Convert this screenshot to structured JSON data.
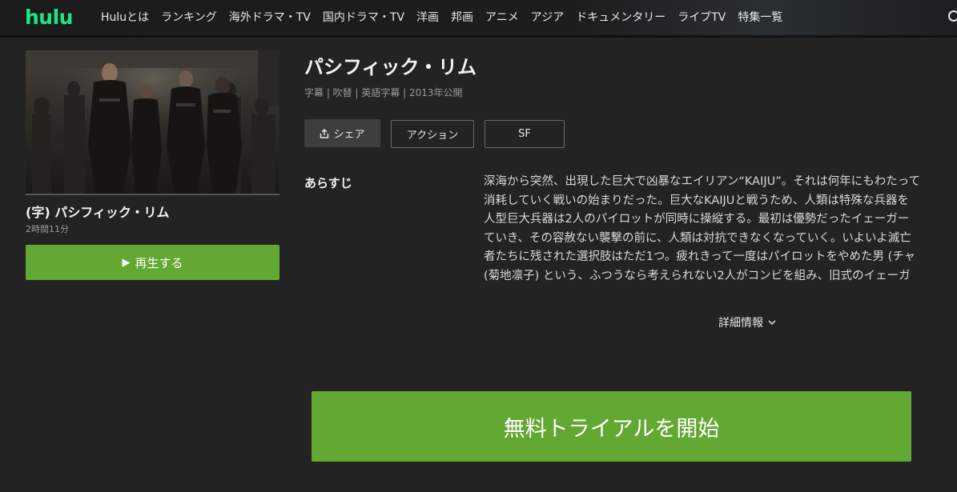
{
  "header": {
    "logo": "hulu",
    "nav": [
      "Huluとは",
      "ランキング",
      "海外ドラマ・TV",
      "国内ドラマ・TV",
      "洋画",
      "邦画",
      "アニメ",
      "アジア",
      "ドキュメンタリー",
      "ライブTV",
      "特集一覧"
    ]
  },
  "card": {
    "title": "(字) パシフィック・リム",
    "duration": "2時間11分",
    "play_label": "再生する"
  },
  "detail": {
    "title": "パシフィック・リム",
    "meta": "字幕 | 吹替 | 英語字幕 | 2013年公開",
    "share_label": "シェア",
    "tags": [
      "アクション",
      "SF"
    ],
    "synopsis_label": "あらすじ",
    "synopsis_lines": [
      "深海から突然、出現した巨大で凶暴なエイリアン“KAIJU”。それは何年にもわたって",
      "消耗していく戦いの始まりだった。巨大なKAIJUと戦うため、人類は特殊な兵器を",
      "人型巨大兵器は2人のパイロットが同時に操縦する。最初は優勢だったイェーガー",
      "ていき、その容赦ない襲撃の前に、人類は対抗できなくなっていく。いよいよ滅亡",
      "者たちに残された選択肢はただ1つ。疲れきって一度はパイロットをやめた男 (チャ",
      "(菊地凛子) という、ふつうなら考えられない2人がコンビを組み、旧式のイェーガ"
    ],
    "details_label": "詳細情報"
  },
  "cta": {
    "trial_label": "無料トライアルを開始"
  },
  "colors": {
    "accent_green": "#63a832",
    "logo_green": "#1ce783",
    "background": "#232323"
  }
}
